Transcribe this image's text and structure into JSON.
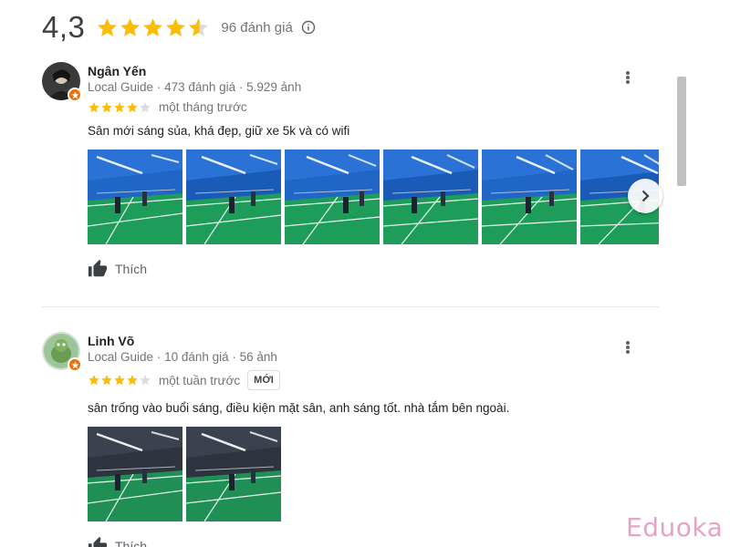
{
  "summary": {
    "rating": "4,3",
    "stars": 4.5,
    "count_label": "96 đánh giá",
    "info_icon": "info-icon"
  },
  "colors": {
    "star": "#fbbc04",
    "star_empty": "#dadce0",
    "guide_badge": "#e8710a",
    "watermark": "#e7a2c7"
  },
  "reviews": [
    {
      "name": "Ngân Yến",
      "local_guide": "Local Guide",
      "review_count": "473 đánh giá",
      "photo_count": "5.929 ảnh",
      "stars": 4,
      "time": "một tháng trước",
      "text": "Sân mới sáng sủa, khá đẹp, giữ xe 5k và có wifi",
      "photos": 6,
      "like_label": "Thích",
      "next_icon": "chevron-right-icon"
    },
    {
      "name": "Linh Võ",
      "local_guide": "Local Guide",
      "review_count": "10 đánh giá",
      "photo_count": "56 ảnh",
      "stars": 4,
      "time": "một tuần trước",
      "badge": "MỚI",
      "text": "sân trống vào buổi sáng, điều kiện mặt sân, anh sáng tốt. nhà tắm bên ngoài.",
      "photos": 2,
      "like_label": "Thích"
    }
  ],
  "separator": " · ",
  "watermark": "Eduoka"
}
